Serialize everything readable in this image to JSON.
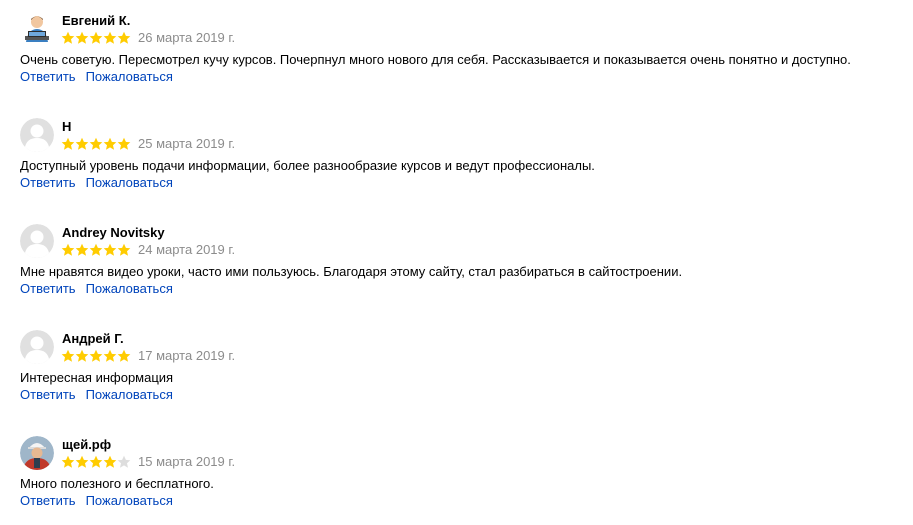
{
  "colors": {
    "star_filled": "#fc0",
    "star_empty": "#dddddd",
    "link": "#0044bb",
    "date": "#8c8c8c"
  },
  "reviews": [
    {
      "author": "Евгений К.",
      "avatar": "user-laptop-avatar-icon",
      "rating": 5,
      "date": "26 марта 2019 г.",
      "text": "Очень советую. Пересмотрел кучу курсов. Почерпнул много нового для себя. Рассказывается и показывается очень понятно и доступно.",
      "reply_label": "Ответить",
      "report_label": "Пожаловаться"
    },
    {
      "author": "Н",
      "avatar": "default-user-avatar-icon",
      "rating": 5,
      "date": "25 марта 2019 г.",
      "text": "Доступный уровень подачи информации, более разнообразие курсов и ведут профессионалы.",
      "reply_label": "Ответить",
      "report_label": "Пожаловаться"
    },
    {
      "author": "Andrey Novitsky",
      "avatar": "default-user-avatar-icon",
      "rating": 5,
      "date": "24 марта 2019 г.",
      "text": "Мне нравятся видео уроки, часто ими пользуюсь. Благодаря этому сайту, стал разбираться в сайтостроении.",
      "reply_label": "Ответить",
      "report_label": "Пожаловаться"
    },
    {
      "author": "Андрей Г.",
      "avatar": "default-user-avatar-icon",
      "rating": 5,
      "date": "17 марта 2019 г.",
      "text": "Интересная информация",
      "reply_label": "Ответить",
      "report_label": "Пожаловаться"
    },
    {
      "author": "щей.рф",
      "avatar": "worker-photo-avatar-icon",
      "rating": 4,
      "date": "15 марта 2019 г.",
      "text": "Много полезного и бесплатного.",
      "reply_label": "Ответить",
      "report_label": "Пожаловаться"
    }
  ]
}
